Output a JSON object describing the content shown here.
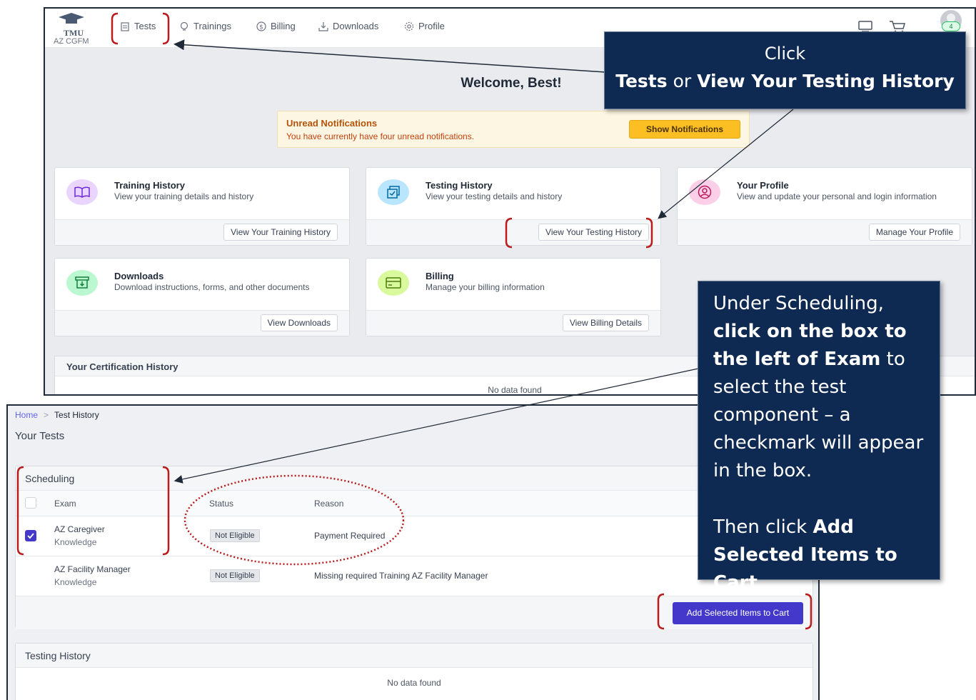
{
  "top": {
    "logo": {
      "line1": "TMU",
      "line2": "AZ CGFM"
    },
    "nav": [
      "Tests",
      "Trainings",
      "Billing",
      "Downloads",
      "Profile"
    ],
    "avatar_badge": "4",
    "welcome": "Welcome, Best!",
    "notification": {
      "title": "Unread Notifications",
      "text": "You have currently have four unread notifications.",
      "button": "Show Notifications"
    },
    "cards": [
      {
        "title": "Training History",
        "desc": "View your training details and history",
        "button": "View Your Training History",
        "icon": "book-icon",
        "color": "#e9d5ff"
      },
      {
        "title": "Testing History",
        "desc": "View your testing details and history",
        "button": "View Your Testing History",
        "icon": "tests-icon",
        "color": "#bae6fd"
      },
      {
        "title": "Your Profile",
        "desc": "View and update your personal and login information",
        "button": "Manage Your Profile",
        "icon": "user-circle-icon",
        "color": "#fbcfe8"
      },
      {
        "title": "Downloads",
        "desc": "Download instructions, forms, and other documents",
        "button": "View Downloads",
        "icon": "download-box-icon",
        "color": "#bbf7d0"
      },
      {
        "title": "Billing",
        "desc": "Manage your billing information",
        "button": "View Billing Details",
        "icon": "credit-card-icon",
        "color": "#d9f99d"
      }
    ],
    "cert_history": {
      "title": "Your Certification History",
      "empty": "No data found"
    }
  },
  "bottom": {
    "breadcrumb": {
      "home": "Home",
      "separator": ">",
      "current": "Test History"
    },
    "page_title": "Your Tests",
    "scheduling": {
      "title": "Scheduling",
      "columns": [
        "Exam",
        "Status",
        "Reason"
      ],
      "rows": [
        {
          "exam_line1": "AZ Caregiver",
          "exam_line2": "Knowledge",
          "status": "Not Eligible",
          "reason": "Payment Required",
          "checked": true
        },
        {
          "exam_line1": "AZ Facility Manager",
          "exam_line2": "Knowledge",
          "status": "Not Eligible",
          "reason": "Missing required Training AZ Facility Manager",
          "checked": false
        }
      ],
      "add_button": "Add Selected Items to Cart"
    },
    "testing_history": {
      "title": "Testing History",
      "empty": "No data found"
    }
  },
  "callouts": {
    "first": {
      "line1": "Click",
      "tests": "Tests",
      "or": " or ",
      "view": "View Your Testing History"
    },
    "second": {
      "p1a": "Under Scheduling, ",
      "p1b": "click on the box to the left of Exam",
      "p1c": " to select the test component – a checkmark will appear in the box.",
      "p2a": "Then click ",
      "p2b": "Add Selected Items to Cart"
    }
  },
  "colors": {
    "annotation_red": "#b91c1c",
    "callout_bg": "#0f2a52",
    "primary_button": "#4338ca",
    "notif_button": "#fbbf24"
  }
}
